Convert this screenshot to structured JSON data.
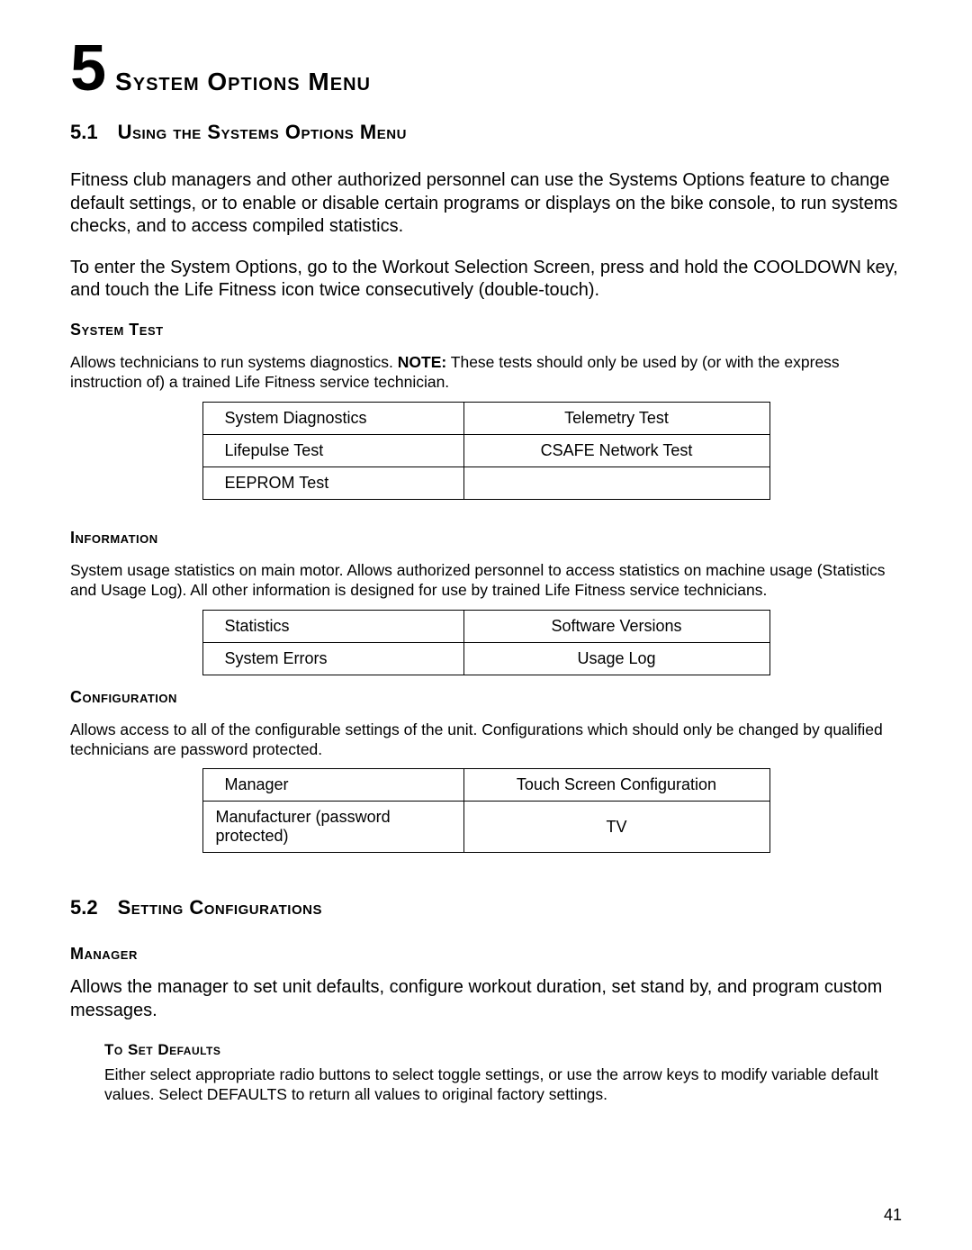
{
  "chapter": {
    "number": "5",
    "title": "System Options Menu"
  },
  "section51": {
    "number": "5.1",
    "title": "Using the Systems Options Menu",
    "para1": "Fitness club managers and other authorized personnel can use the Systems Options feature to change default settings, or to enable or disable certain programs or displays on the bike console, to run systems checks, and to access compiled statistics.",
    "para2": "To enter the System Options, go to the Workout Selection Screen, press and hold the COOLDOWN key, and touch the Life Fitness icon twice consecutively (double-touch)."
  },
  "system_test": {
    "heading": "System Test",
    "desc_pre": "Allows technicians to run systems diagnostics. ",
    "note_label": "NOTE:",
    "desc_post": " These tests should only be used by (or with the express instruction of) a trained Life Fitness service technician.",
    "rows": [
      {
        "left": "System Diagnostics",
        "right": "Telemetry Test"
      },
      {
        "left": "Lifepulse Test",
        "right": "CSAFE Network Test"
      },
      {
        "left": "EEPROM Test",
        "right": ""
      }
    ]
  },
  "information": {
    "heading": "Information",
    "desc": "System usage statistics on main motor. Allows authorized personnel to access statistics on machine usage (Statistics and Usage Log). All other information is designed for use by trained Life Fitness service technicians.",
    "rows": [
      {
        "left": "Statistics",
        "right": "Software Versions"
      },
      {
        "left": "System Errors",
        "right": "Usage Log"
      }
    ]
  },
  "configuration": {
    "heading": "Configuration",
    "desc": "Allows access to all of the configurable settings of the unit. Configurations which should only be changed by qualified technicians are password protected.",
    "rows": [
      {
        "left": "Manager",
        "right": "Touch Screen Configuration"
      },
      {
        "left": "Manufacturer (password protected)",
        "right": "TV"
      }
    ]
  },
  "section52": {
    "number": "5.2",
    "title": "Setting Configurations"
  },
  "manager": {
    "heading": "Manager",
    "desc": "Allows the manager to set unit defaults, configure workout duration, set stand by, and program custom messages."
  },
  "to_set_defaults": {
    "heading": "To Set Defaults",
    "desc": "Either select appropriate radio buttons to select toggle settings, or use the arrow keys to modify variable default values. Select DEFAULTS to return all values to original factory settings."
  },
  "page_number": "41"
}
